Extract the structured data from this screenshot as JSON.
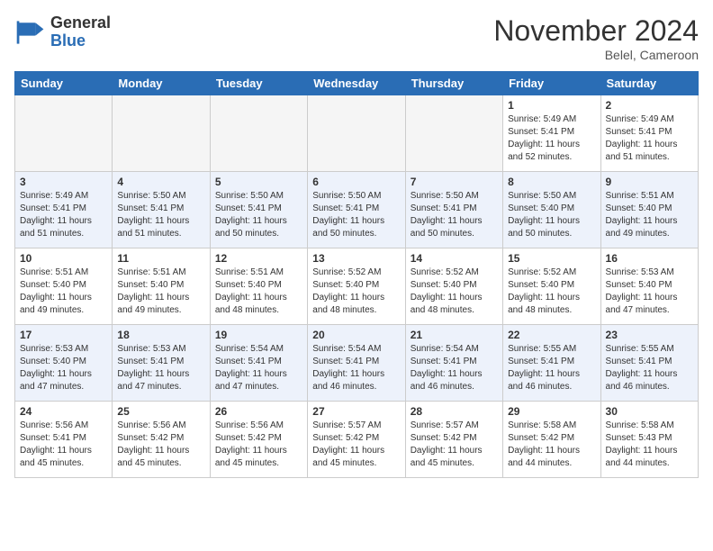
{
  "logo": {
    "general": "General",
    "blue": "Blue"
  },
  "title": "November 2024",
  "location": "Belel, Cameroon",
  "weekdays": [
    "Sunday",
    "Monday",
    "Tuesday",
    "Wednesday",
    "Thursday",
    "Friday",
    "Saturday"
  ],
  "weeks": [
    [
      {
        "day": "",
        "info": ""
      },
      {
        "day": "",
        "info": ""
      },
      {
        "day": "",
        "info": ""
      },
      {
        "day": "",
        "info": ""
      },
      {
        "day": "",
        "info": ""
      },
      {
        "day": "1",
        "info": "Sunrise: 5:49 AM\nSunset: 5:41 PM\nDaylight: 11 hours\nand 52 minutes."
      },
      {
        "day": "2",
        "info": "Sunrise: 5:49 AM\nSunset: 5:41 PM\nDaylight: 11 hours\nand 51 minutes."
      }
    ],
    [
      {
        "day": "3",
        "info": "Sunrise: 5:49 AM\nSunset: 5:41 PM\nDaylight: 11 hours\nand 51 minutes."
      },
      {
        "day": "4",
        "info": "Sunrise: 5:50 AM\nSunset: 5:41 PM\nDaylight: 11 hours\nand 51 minutes."
      },
      {
        "day": "5",
        "info": "Sunrise: 5:50 AM\nSunset: 5:41 PM\nDaylight: 11 hours\nand 50 minutes."
      },
      {
        "day": "6",
        "info": "Sunrise: 5:50 AM\nSunset: 5:41 PM\nDaylight: 11 hours\nand 50 minutes."
      },
      {
        "day": "7",
        "info": "Sunrise: 5:50 AM\nSunset: 5:41 PM\nDaylight: 11 hours\nand 50 minutes."
      },
      {
        "day": "8",
        "info": "Sunrise: 5:50 AM\nSunset: 5:40 PM\nDaylight: 11 hours\nand 50 minutes."
      },
      {
        "day": "9",
        "info": "Sunrise: 5:51 AM\nSunset: 5:40 PM\nDaylight: 11 hours\nand 49 minutes."
      }
    ],
    [
      {
        "day": "10",
        "info": "Sunrise: 5:51 AM\nSunset: 5:40 PM\nDaylight: 11 hours\nand 49 minutes."
      },
      {
        "day": "11",
        "info": "Sunrise: 5:51 AM\nSunset: 5:40 PM\nDaylight: 11 hours\nand 49 minutes."
      },
      {
        "day": "12",
        "info": "Sunrise: 5:51 AM\nSunset: 5:40 PM\nDaylight: 11 hours\nand 48 minutes."
      },
      {
        "day": "13",
        "info": "Sunrise: 5:52 AM\nSunset: 5:40 PM\nDaylight: 11 hours\nand 48 minutes."
      },
      {
        "day": "14",
        "info": "Sunrise: 5:52 AM\nSunset: 5:40 PM\nDaylight: 11 hours\nand 48 minutes."
      },
      {
        "day": "15",
        "info": "Sunrise: 5:52 AM\nSunset: 5:40 PM\nDaylight: 11 hours\nand 48 minutes."
      },
      {
        "day": "16",
        "info": "Sunrise: 5:53 AM\nSunset: 5:40 PM\nDaylight: 11 hours\nand 47 minutes."
      }
    ],
    [
      {
        "day": "17",
        "info": "Sunrise: 5:53 AM\nSunset: 5:40 PM\nDaylight: 11 hours\nand 47 minutes."
      },
      {
        "day": "18",
        "info": "Sunrise: 5:53 AM\nSunset: 5:41 PM\nDaylight: 11 hours\nand 47 minutes."
      },
      {
        "day": "19",
        "info": "Sunrise: 5:54 AM\nSunset: 5:41 PM\nDaylight: 11 hours\nand 47 minutes."
      },
      {
        "day": "20",
        "info": "Sunrise: 5:54 AM\nSunset: 5:41 PM\nDaylight: 11 hours\nand 46 minutes."
      },
      {
        "day": "21",
        "info": "Sunrise: 5:54 AM\nSunset: 5:41 PM\nDaylight: 11 hours\nand 46 minutes."
      },
      {
        "day": "22",
        "info": "Sunrise: 5:55 AM\nSunset: 5:41 PM\nDaylight: 11 hours\nand 46 minutes."
      },
      {
        "day": "23",
        "info": "Sunrise: 5:55 AM\nSunset: 5:41 PM\nDaylight: 11 hours\nand 46 minutes."
      }
    ],
    [
      {
        "day": "24",
        "info": "Sunrise: 5:56 AM\nSunset: 5:41 PM\nDaylight: 11 hours\nand 45 minutes."
      },
      {
        "day": "25",
        "info": "Sunrise: 5:56 AM\nSunset: 5:42 PM\nDaylight: 11 hours\nand 45 minutes."
      },
      {
        "day": "26",
        "info": "Sunrise: 5:56 AM\nSunset: 5:42 PM\nDaylight: 11 hours\nand 45 minutes."
      },
      {
        "day": "27",
        "info": "Sunrise: 5:57 AM\nSunset: 5:42 PM\nDaylight: 11 hours\nand 45 minutes."
      },
      {
        "day": "28",
        "info": "Sunrise: 5:57 AM\nSunset: 5:42 PM\nDaylight: 11 hours\nand 45 minutes."
      },
      {
        "day": "29",
        "info": "Sunrise: 5:58 AM\nSunset: 5:42 PM\nDaylight: 11 hours\nand 44 minutes."
      },
      {
        "day": "30",
        "info": "Sunrise: 5:58 AM\nSunset: 5:43 PM\nDaylight: 11 hours\nand 44 minutes."
      }
    ]
  ]
}
